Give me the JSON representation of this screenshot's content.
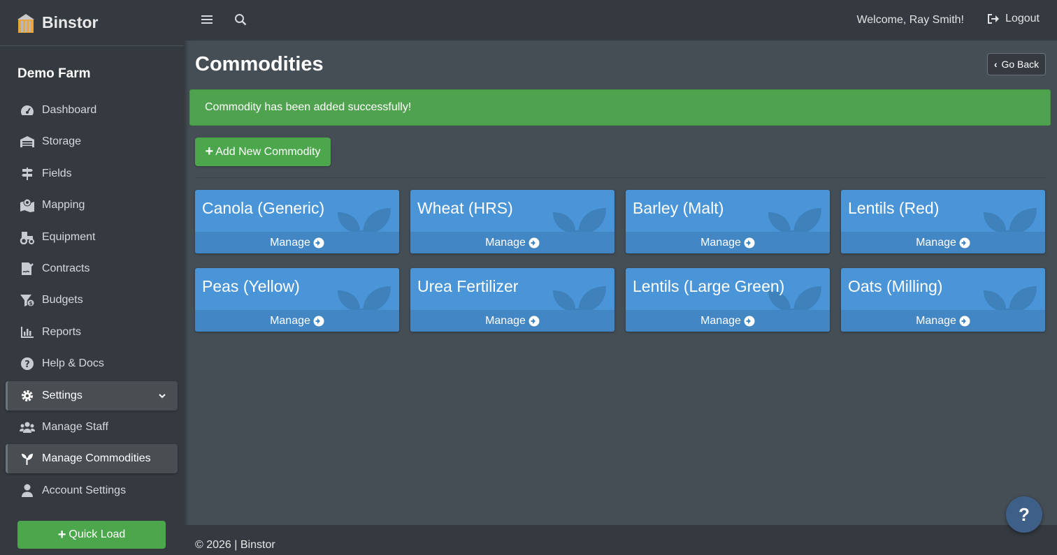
{
  "app": {
    "brand": "Binstor",
    "farm": "Demo Farm"
  },
  "sidebar": {
    "items": [
      {
        "label": "Dashboard",
        "icon": "dashboard-gauge-icon"
      },
      {
        "label": "Storage",
        "icon": "warehouse-icon"
      },
      {
        "label": "Fields",
        "icon": "signpost-icon"
      },
      {
        "label": "Mapping",
        "icon": "map-pin-icon"
      },
      {
        "label": "Equipment",
        "icon": "tractor-icon"
      },
      {
        "label": "Contracts",
        "icon": "file-signature-icon"
      },
      {
        "label": "Budgets",
        "icon": "funnel-dollar-icon"
      },
      {
        "label": "Reports",
        "icon": "bar-chart-icon"
      },
      {
        "label": "Help & Docs",
        "icon": "question-circle-icon"
      },
      {
        "label": "Settings",
        "icon": "gear-icon"
      },
      {
        "label": "Manage Staff",
        "icon": "users-icon"
      },
      {
        "label": "Manage Commodities",
        "icon": "seedling-icon"
      },
      {
        "label": "Account Settings",
        "icon": "user-icon"
      }
    ],
    "quick_load": "Quick Load"
  },
  "topbar": {
    "welcome": "Welcome, Ray Smith!",
    "logout": "Logout"
  },
  "main": {
    "title": "Commodities",
    "go_back": "Go Back",
    "alert": "Commodity has been added successfully!",
    "add_button": "Add New Commodity",
    "manage_label": "Manage",
    "commodities": [
      "Canola (Generic)",
      "Wheat (HRS)",
      "Barley (Malt)",
      "Lentils (Red)",
      "Peas (Yellow)",
      "Urea Fertilizer",
      "Lentils (Large Green)",
      "Oats (Milling)"
    ]
  },
  "footer": {
    "text": "© 2026 | Binstor"
  },
  "help_fab": "?",
  "colors": {
    "sidebar": "#343a40",
    "content": "#454d55",
    "success": "#4fa34f",
    "card": "#4a95d8",
    "card_footer": "#4386c4"
  }
}
